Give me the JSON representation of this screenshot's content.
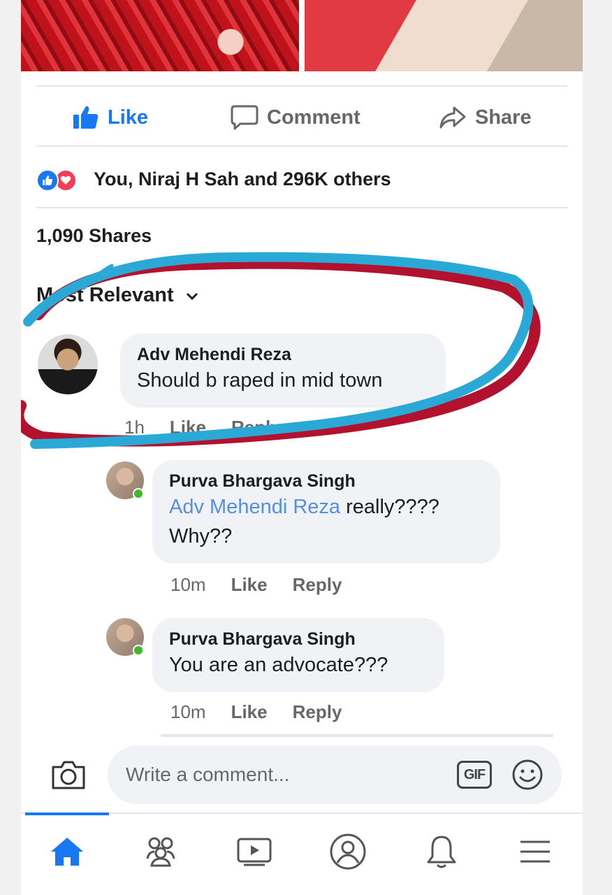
{
  "post": {
    "actions": {
      "like": "Like",
      "comment": "Comment",
      "share": "Share"
    },
    "reactions_text": "You, Niraj H Sah and 296K others",
    "shares": "1,090 Shares",
    "sort_label": "Most Relevant"
  },
  "comments": [
    {
      "author": "Adv Mehendi Reza",
      "text": "Should b raped in mid town",
      "time": "1h",
      "like": "Like",
      "reply": "Reply"
    }
  ],
  "replies": [
    {
      "author": "Purva Bhargava Singh",
      "mention": "Adv Mehendi Reza",
      "text_line1": " really????",
      "text_line2": "Why??",
      "time": "10m",
      "like": "Like",
      "reply": "Reply"
    },
    {
      "author": "Purva Bhargava Singh",
      "text": "You are an advocate???",
      "time": "10m",
      "like": "Like",
      "reply": "Reply"
    }
  ],
  "composer": {
    "placeholder": "Write a comment...",
    "gif_label": "GIF"
  },
  "nav": [
    "home-icon",
    "friends-icon",
    "watch-icon",
    "profile-icon",
    "notifications-icon",
    "menu-icon"
  ],
  "colors": {
    "accent": "#1877f2",
    "love": "#f33e58",
    "bubble": "#f0f2f5",
    "scribble_blue": "#2aa8d6",
    "scribble_red": "#b3122e"
  }
}
